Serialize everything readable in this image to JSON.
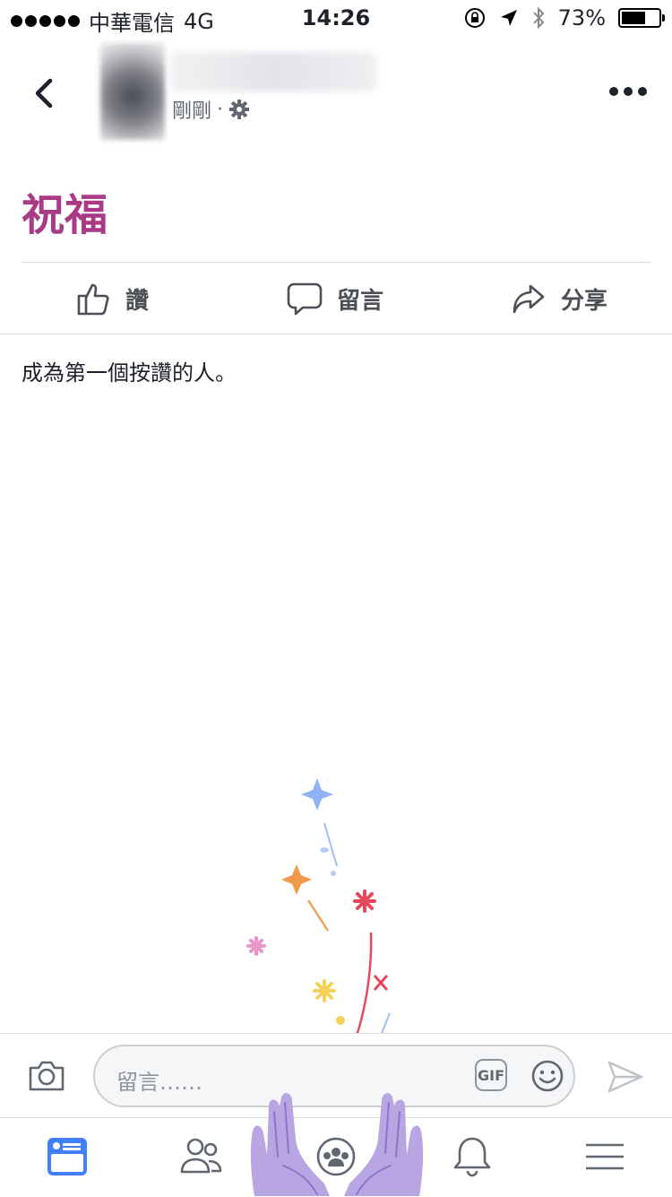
{
  "status_bar": {
    "carrier": "中華電信",
    "network": "4G",
    "time": "14:26",
    "battery": "73%",
    "battery_level": 0.73
  },
  "post": {
    "timestamp": "剛剛",
    "separator": "·",
    "text": "祝福",
    "text_color": "#a83a86"
  },
  "actions": {
    "like": "讚",
    "comment": "留言",
    "share": "分享"
  },
  "reactions": {
    "first_like": "成為第一個按讚的人。"
  },
  "comment_bar": {
    "placeholder": "留言……",
    "gif_label": "GIF"
  },
  "tab_bar": {
    "active_color": "#4080ff",
    "items": [
      "news-feed",
      "friends",
      "groups",
      "notifications",
      "menu"
    ]
  },
  "icons": [
    "back-icon",
    "more-icon",
    "settings-icon",
    "like-icon",
    "comment-icon",
    "share-icon",
    "camera-icon",
    "emoji-icon",
    "send-icon"
  ]
}
